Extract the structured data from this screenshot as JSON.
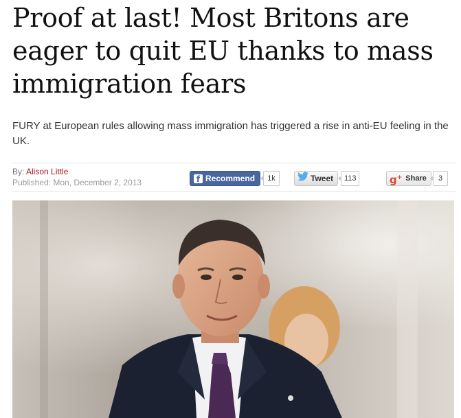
{
  "article": {
    "headline": "Proof at last! Most Britons are eager to quit EU thanks to mass immigration fears",
    "standfirst": "FURY at European rules allowing mass immigration has triggered a rise in anti-EU feeling in the UK.",
    "byline_label": "By:",
    "author": "Alison Little",
    "published": "Published: Mon, December 2, 2013"
  },
  "social": {
    "facebook": {
      "icon": "facebook-icon",
      "label": "Recommend",
      "count": "1k",
      "color": "#4a66a0"
    },
    "twitter": {
      "icon": "twitter-bird-icon",
      "label": "Tweet",
      "count": "113",
      "color": "#55acee"
    },
    "googleplus": {
      "icon": "google-plus-icon",
      "label": "Share",
      "count": "3",
      "color": "#d6492f"
    }
  },
  "colors": {
    "author_link": "#a0161c",
    "headline": "#111111"
  }
}
